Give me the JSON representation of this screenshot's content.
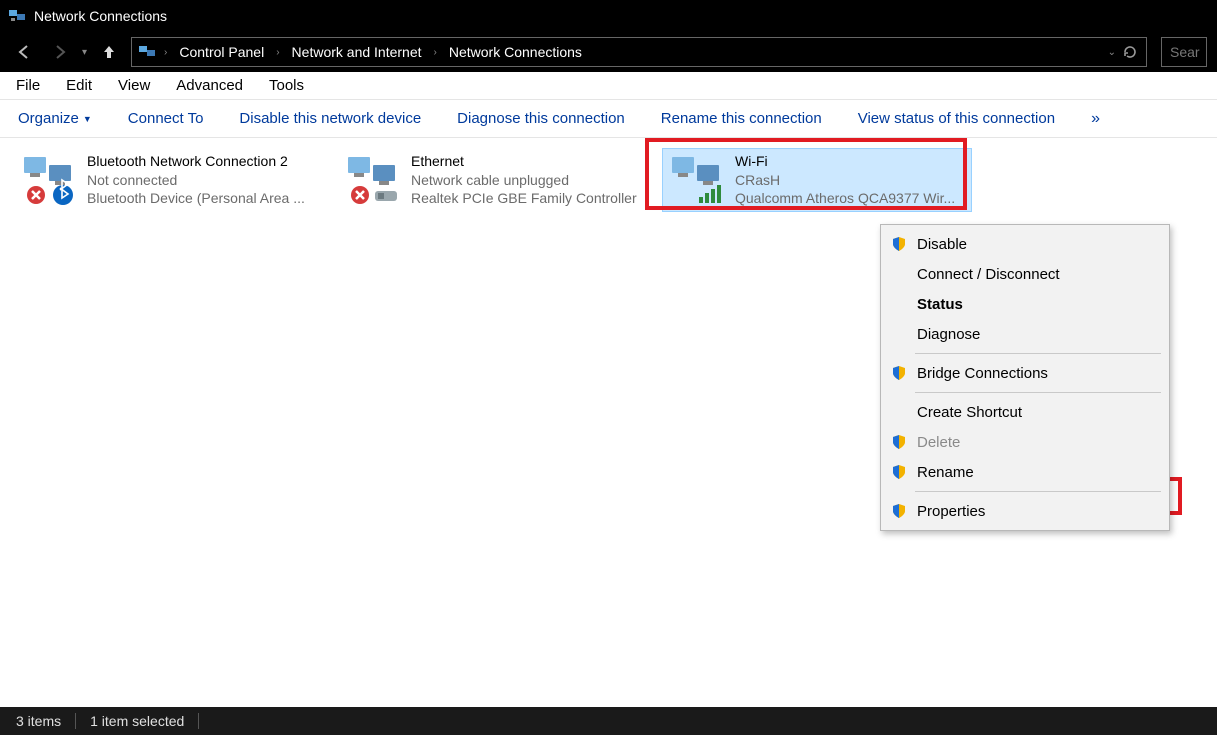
{
  "titlebar": {
    "title": "Network Connections"
  },
  "breadcrumb": {
    "items": [
      "Control Panel",
      "Network and Internet",
      "Network Connections"
    ]
  },
  "search": {
    "placeholder": "Sear"
  },
  "menubar": {
    "items": [
      "File",
      "Edit",
      "View",
      "Advanced",
      "Tools"
    ]
  },
  "cmdbar": {
    "organize": "Organize",
    "items": [
      "Connect To",
      "Disable this network device",
      "Diagnose this connection",
      "Rename this connection",
      "View status of this connection"
    ],
    "overflow": "»"
  },
  "adapters": [
    {
      "name": "Bluetooth Network Connection 2",
      "status": "Not connected",
      "device": "Bluetooth Device (Personal Area ..."
    },
    {
      "name": "Ethernet",
      "status": "Network cable unplugged",
      "device": "Realtek PCIe GBE Family Controller"
    },
    {
      "name": "Wi-Fi",
      "status": "CRasH",
      "device": "Qualcomm Atheros QCA9377 Wir..."
    }
  ],
  "context_menu": {
    "disable": "Disable",
    "connect": "Connect / Disconnect",
    "status": "Status",
    "diagnose": "Diagnose",
    "bridge": "Bridge Connections",
    "shortcut": "Create Shortcut",
    "delete": "Delete",
    "rename": "Rename",
    "properties": "Properties"
  },
  "statusbar": {
    "count": "3 items",
    "selected": "1 item selected"
  },
  "colors": {
    "accent": "#003a9c",
    "highlight": "#e11b22",
    "selection": "#cce8ff"
  }
}
